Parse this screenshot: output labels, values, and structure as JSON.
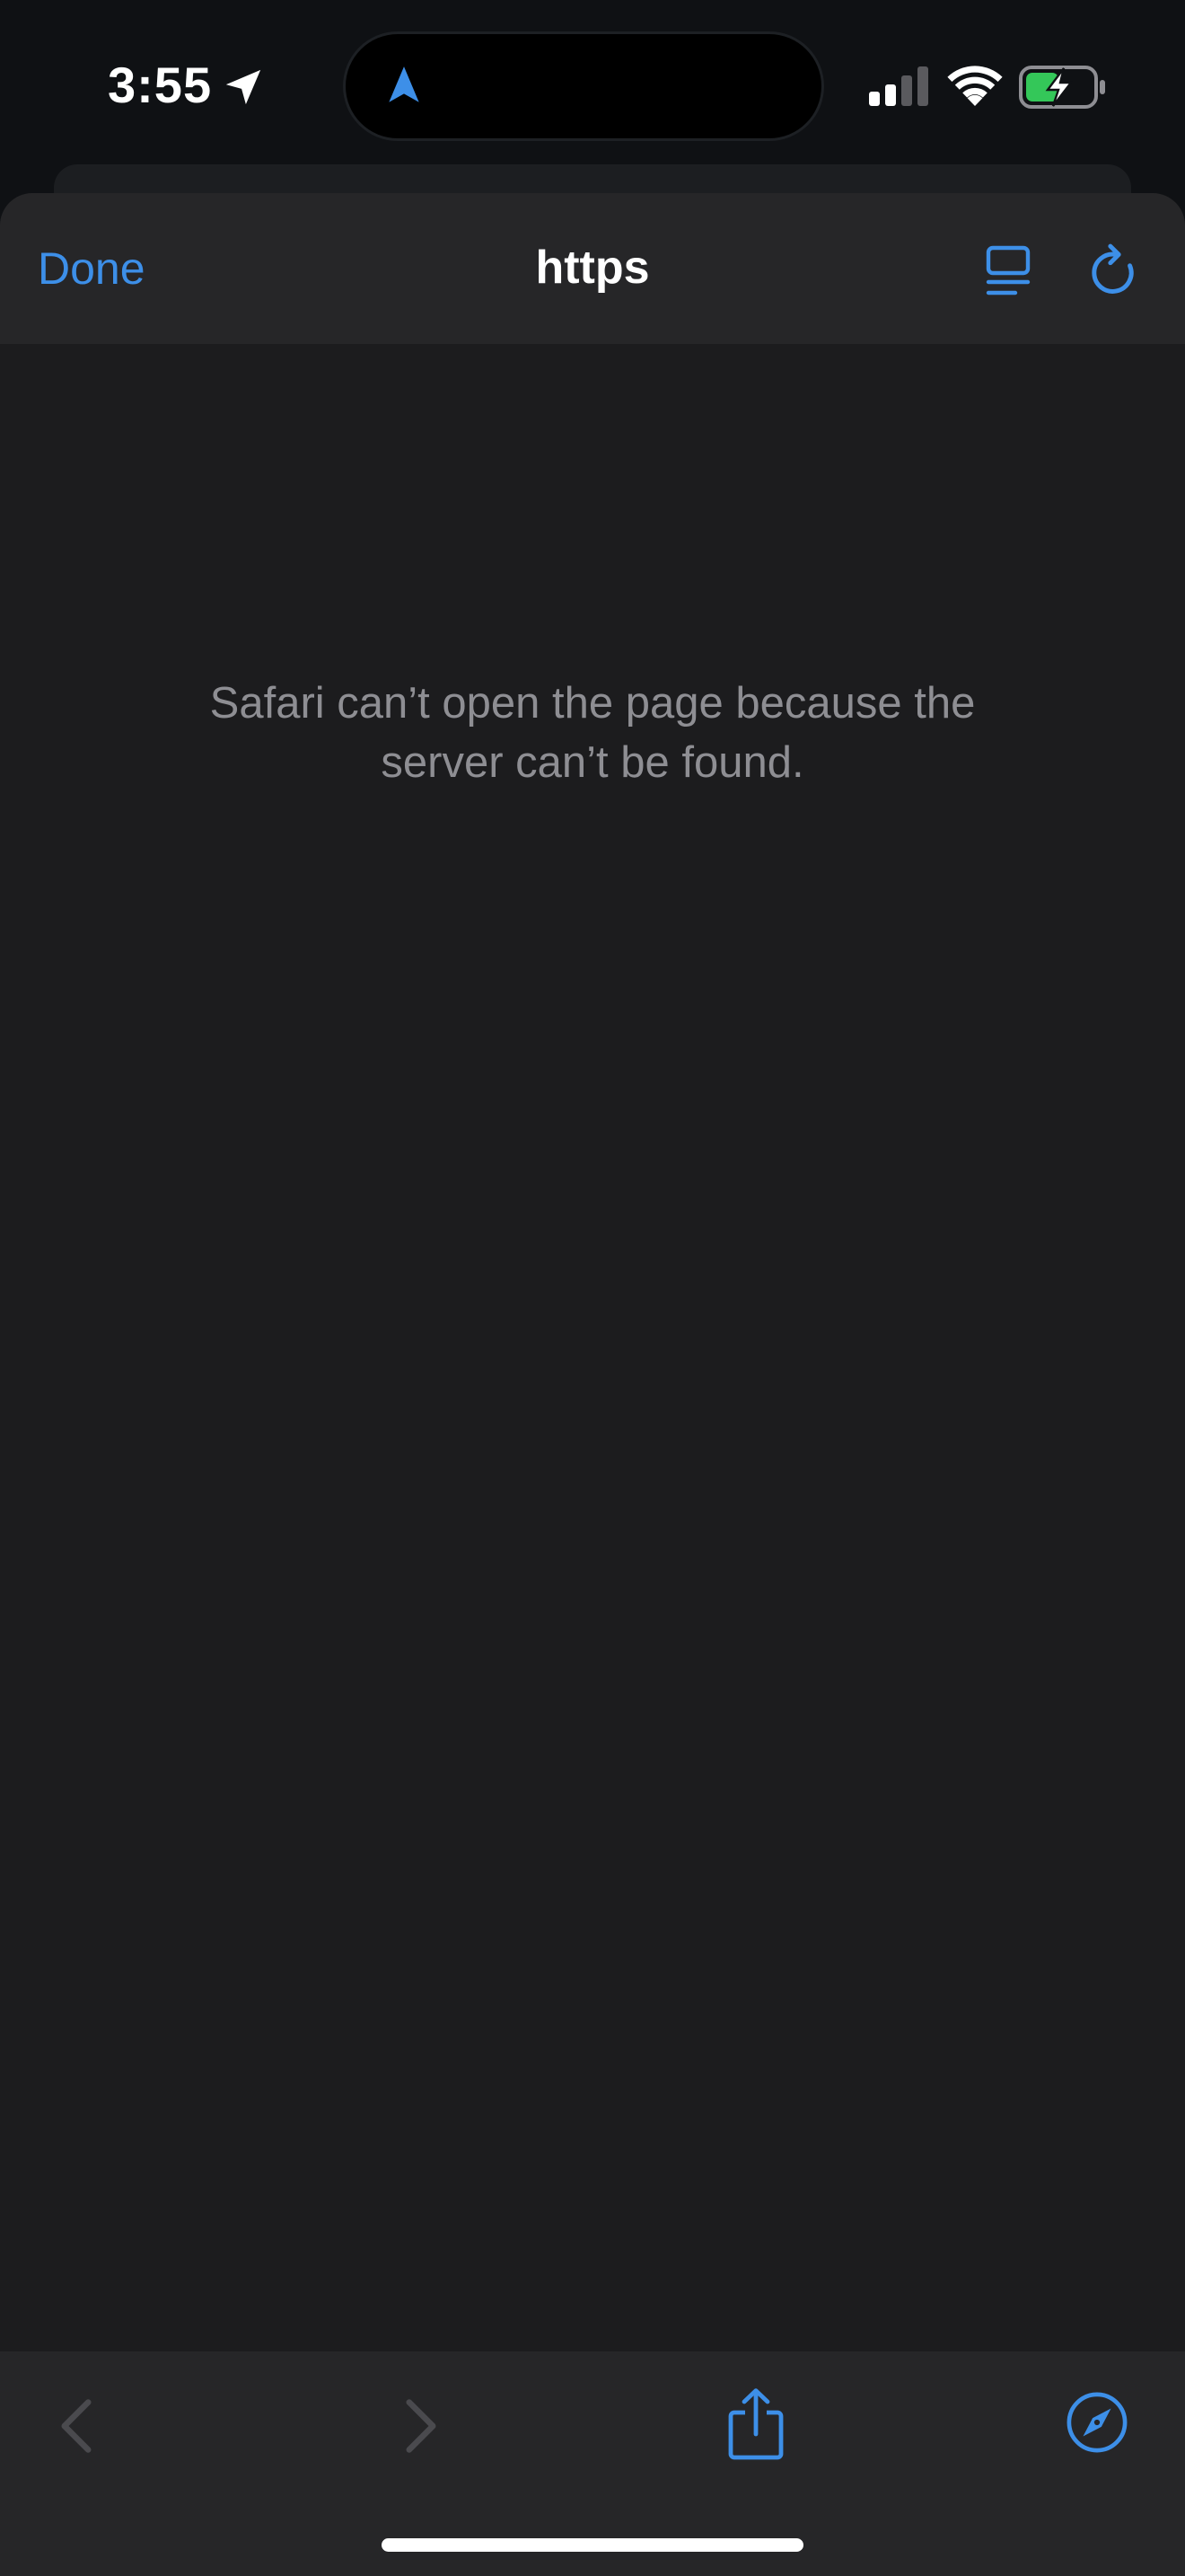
{
  "status_bar": {
    "time": "3:55",
    "icons": [
      "location-arrow-icon",
      "navigation-icon",
      "cellular-signal-icon",
      "wifi-icon",
      "battery-charging-icon"
    ],
    "accent_color": "#3d8fe8",
    "battery_color": "#34c759"
  },
  "nav_bar": {
    "done_label": "Done",
    "title": "https",
    "icons": [
      "reader-view-icon",
      "reload-icon"
    ]
  },
  "content": {
    "error_message": "Safari can’t open the page because the server can’t be found."
  },
  "toolbar": {
    "icons": [
      "back-chevron-icon",
      "forward-chevron-icon",
      "share-icon",
      "compass-icon"
    ],
    "back_enabled": false,
    "forward_enabled": false
  }
}
